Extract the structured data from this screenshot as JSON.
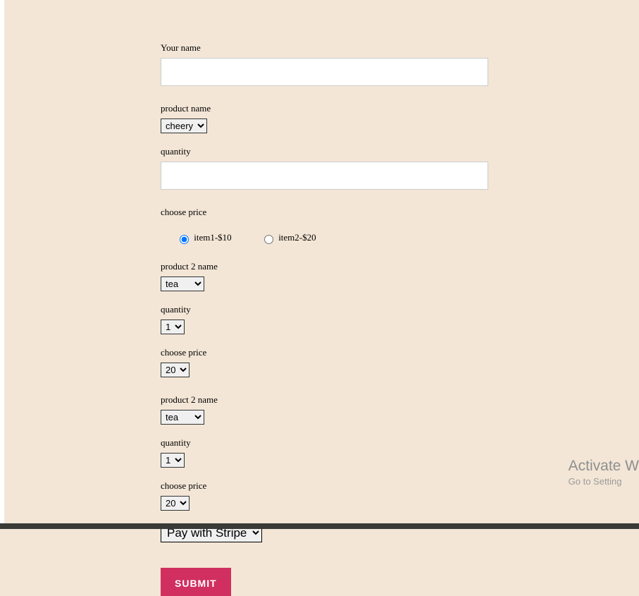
{
  "form": {
    "name": {
      "label": "Your name",
      "value": ""
    },
    "product1": {
      "name_label": "product name",
      "name_value": "cheery",
      "quantity_label": "quantity",
      "quantity_value": "",
      "price_label": "choose price",
      "radio1": "item1-$10",
      "radio2": "item2-$20"
    },
    "product2": {
      "name_label": "product 2 name",
      "name_value": "tea",
      "quantity_label": "quantity",
      "quantity_value": "1",
      "price_label": "choose price",
      "price_value": "20"
    },
    "product3": {
      "name_label": "product 2 name",
      "name_value": "tea",
      "quantity_label": "quantity",
      "quantity_value": "1",
      "price_label": "choose price",
      "price_value": "20"
    },
    "payment": {
      "value": "Pay with Stripe"
    },
    "submit_label": "SUBMIT"
  },
  "watermark": {
    "title": "Activate W",
    "sub": "Go to Setting"
  }
}
